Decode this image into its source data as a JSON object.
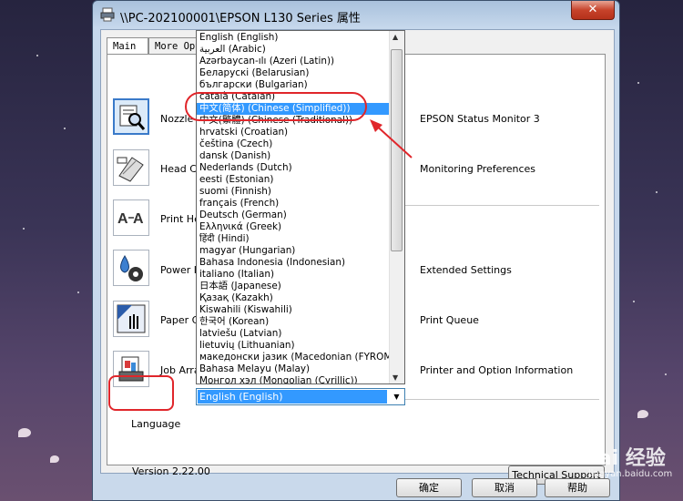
{
  "window": {
    "title": "\\\\PC-202100001\\EPSON L130 Series 属性",
    "close_glyph": "✕"
  },
  "tabs": [
    {
      "label": "Main"
    },
    {
      "label": "More Opt"
    }
  ],
  "utilities": [
    {
      "label": "Nozzle Ch",
      "icon": "nozzle-check-icon"
    },
    {
      "label": "Head Clea",
      "icon": "head-cleaning-icon"
    },
    {
      "label": "Print Head",
      "icon": "print-head-alignment-icon"
    },
    {
      "label": "Power Ink",
      "icon": "power-ink-flushing-icon"
    },
    {
      "label": "Paper Guid",
      "icon": "paper-guide-icon"
    },
    {
      "label": "Job Arran",
      "icon": "job-arranger-icon"
    }
  ],
  "right_items": [
    {
      "label": "EPSON Status Monitor 3"
    },
    {
      "label": "Monitoring Preferences"
    },
    {
      "label": "Extended Settings"
    },
    {
      "label": "Print Queue"
    },
    {
      "label": "Printer and Option Information"
    }
  ],
  "language": {
    "label": "Language",
    "selected": "English (English)",
    "highlighted_index": 6,
    "options": [
      "English (English)",
      "العربية (Arabic)",
      "Azərbaycan-ılı (Azeri (Latin))",
      "Беларускі (Belarusian)",
      "български (Bulgarian)",
      "català (Catalan)",
      "中文(简体) (Chinese (Simplified))",
      "中文(繁體) (Chinese (Traditional))",
      "hrvatski (Croatian)",
      "čeština (Czech)",
      "dansk (Danish)",
      "Nederlands (Dutch)",
      "eesti (Estonian)",
      "suomi (Finnish)",
      "français (French)",
      "Deutsch (German)",
      "Ελληνικά (Greek)",
      "हिंदी (Hindi)",
      "magyar (Hungarian)",
      "Bahasa Indonesia (Indonesian)",
      "italiano (Italian)",
      "日本語 (Japanese)",
      "Қазақ (Kazakh)",
      "Kiswahili (Kiswahili)",
      "한국어 (Korean)",
      "latviešu (Latvian)",
      "lietuvių (Lithuanian)",
      "македонски јазик (Macedonian (FYROM))",
      "Bahasa Melayu (Malay)",
      "Монгол хэл (Mongolian (Cyrillic))"
    ]
  },
  "version": "Version 2.22.00",
  "technical_support": "Technical Support",
  "buttons": {
    "ok": "确定",
    "cancel": "取消",
    "help": "帮助"
  },
  "watermark": {
    "text": "Bai 经验",
    "sub": "jingyan.baidu.com"
  },
  "colors": {
    "highlight": "#3399ff",
    "annotation": "#e0262b"
  }
}
